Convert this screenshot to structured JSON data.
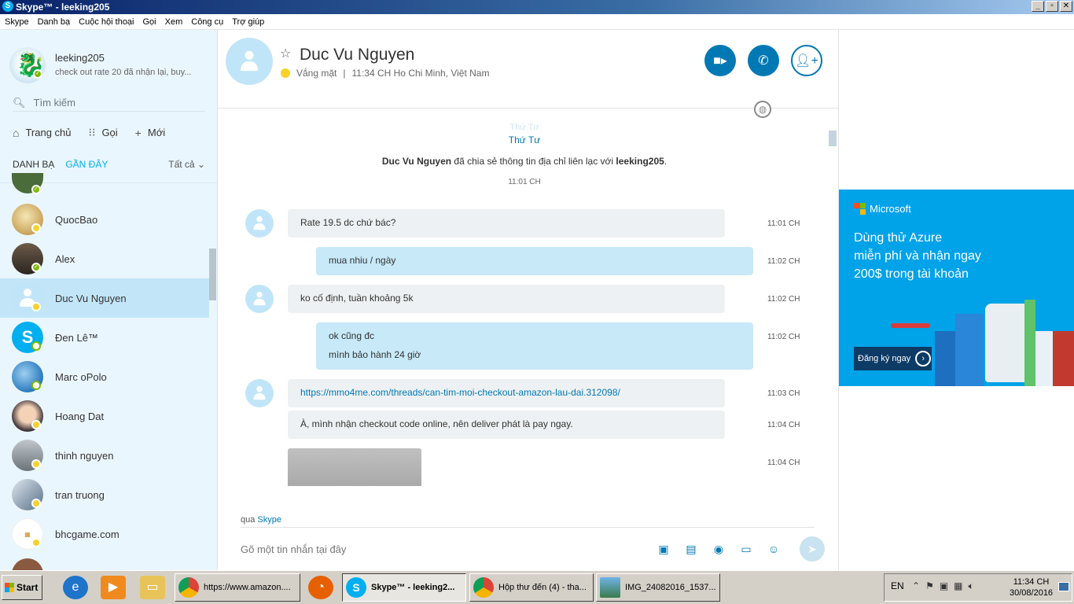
{
  "window": {
    "title": "Skype™ - leeking205",
    "min": "_",
    "max": "▫",
    "close": "✕"
  },
  "menu": [
    "Skype",
    "Danh bạ",
    "Cuộc hội thoại",
    "Gọi",
    "Xem",
    "Công cụ",
    "Trợ giúp"
  ],
  "profile": {
    "name": "leeking205",
    "mood": "check out rate 20 đã nhận lại, buy..."
  },
  "search": {
    "placeholder": "Tìm kiếm"
  },
  "nav": {
    "home": "Trang chủ",
    "call": "Gọi",
    "new": "Mới"
  },
  "tabs": {
    "contacts": "DANH BẠ",
    "recent": "GẦN ĐÂY",
    "filter": "Tất cả"
  },
  "contacts": [
    {
      "name": "QuocBao",
      "status": "away"
    },
    {
      "name": "Alex",
      "status": "online"
    },
    {
      "name": "Duc Vu Nguyen",
      "status": "away",
      "selected": true
    },
    {
      "name": "Đen Lê™",
      "status": "offline"
    },
    {
      "name": "Marc oPolo",
      "status": "offline"
    },
    {
      "name": "Hoang Dat",
      "status": "away"
    },
    {
      "name": "thinh nguyen",
      "status": "away"
    },
    {
      "name": "tran truong",
      "status": "away"
    },
    {
      "name": "bhcgame.com",
      "status": "away"
    }
  ],
  "header": {
    "name": "Duc Vu Nguyen",
    "status": "Vắng mặt",
    "separator": "|",
    "local_time": "11:34 CH Ho Chi Minh, Việt Nam"
  },
  "conversation": {
    "day_faded": "Thứ Tư",
    "day": "Thứ Tư",
    "system": {
      "actor": "Duc Vu Nguyen",
      "text": " đã chia sẻ thông tin địa chỉ liên lạc với ",
      "target": "leeking205",
      "end": "."
    },
    "system_time": "11:01 CH",
    "messages": [
      {
        "dir": "in",
        "text": "Rate 19.5 dc chứ bác?",
        "time": "11:01 CH"
      },
      {
        "dir": "out",
        "text": "mua nhiu / ngày",
        "time": "11:02 CH"
      },
      {
        "dir": "in",
        "text": "ko cố định, tuần khoảng 5k",
        "time": "11:02 CH"
      },
      {
        "dir": "out",
        "line1": "ok cũng đc",
        "line2": "mình bảo hành 24 giờ",
        "time": "11:02 CH"
      },
      {
        "dir": "in",
        "link": "https://mmo4me.com/threads/can-tim-moi-checkout-amazon-lau-dai.312098/",
        "time": "11:03 CH"
      },
      {
        "dir": "in",
        "text": "À, mình nhận checkout code online, nên deliver phát là pay ngay.",
        "time": "11:04 CH"
      },
      {
        "dir": "in",
        "type": "image",
        "time": "11:04 CH"
      }
    ]
  },
  "compose": {
    "via_prefix": "qua ",
    "via_service": "Skype",
    "placeholder": "Gõ một tin nhắn tại đây"
  },
  "ad": {
    "brand": "Microsoft",
    "line1": "Dùng thử Azure",
    "line2": "miễn phí và nhận ngay",
    "line3": "200$ trong tài khoản",
    "cta": "Đăng ký ngay"
  },
  "taskbar": {
    "start": "Start",
    "items": [
      {
        "label": "https://www.amazon...."
      },
      {
        "label": "Skype™ - leeking2...",
        "active": true
      },
      {
        "label": "Hộp thư đến (4) - tha..."
      },
      {
        "label": "IMG_24082016_1537..."
      }
    ],
    "lang": "EN",
    "time": "11:34 CH",
    "date": "30/08/2016"
  },
  "colors": {
    "skype_blue": "#00aff0",
    "call_button": "#0078b4",
    "ad_bg": "#00a2e8",
    "away": "#f8d22a",
    "online": "#7fba00"
  }
}
